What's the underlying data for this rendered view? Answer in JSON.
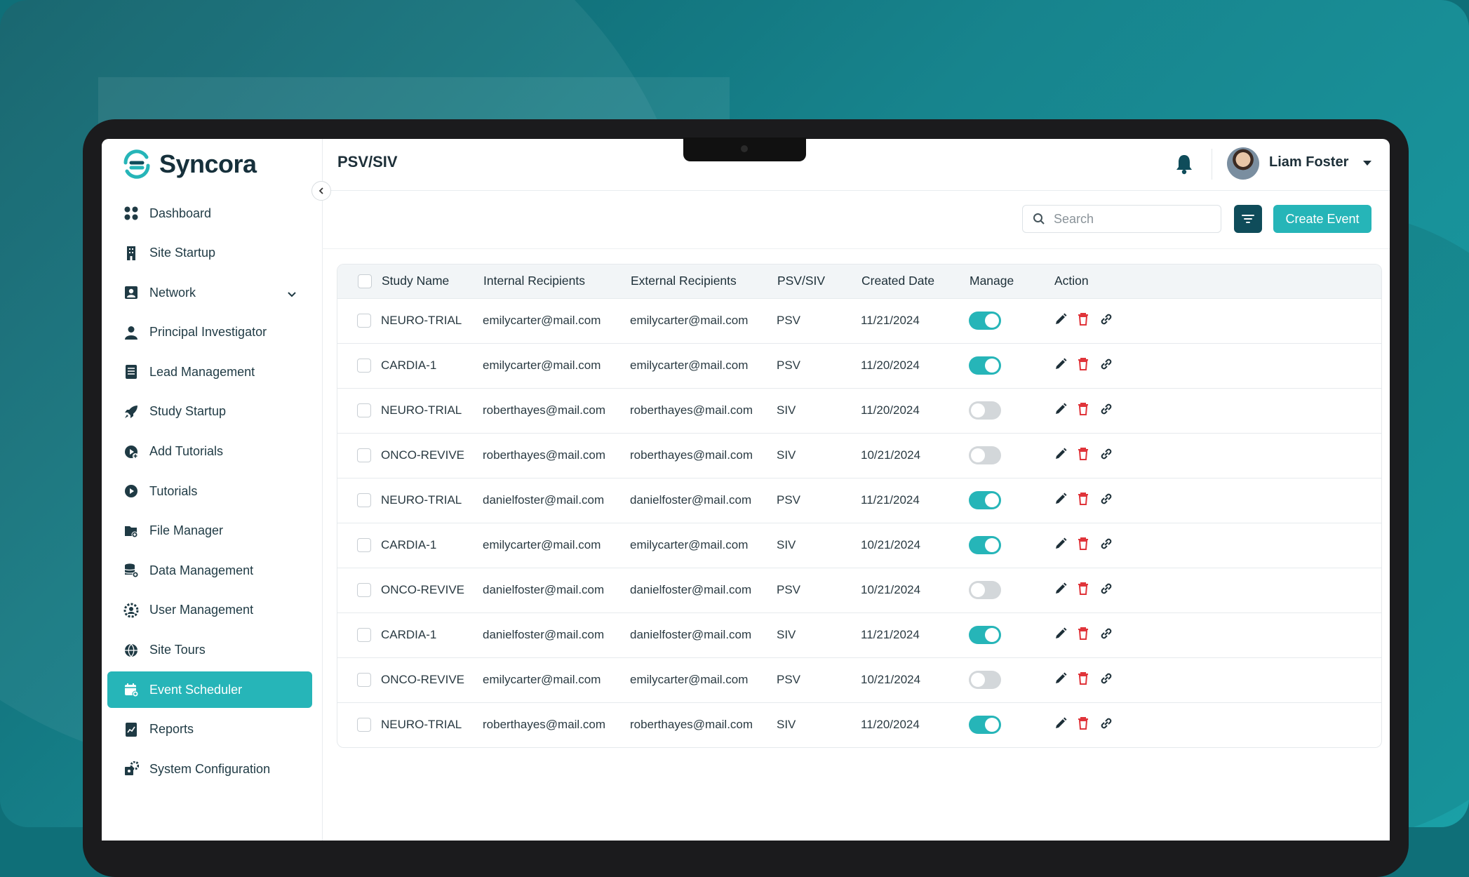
{
  "app": {
    "name": "Syncora"
  },
  "page": {
    "title": "PSV/SIV"
  },
  "user": {
    "name": "Liam Foster"
  },
  "sidebar": {
    "items": [
      {
        "label": "Dashboard",
        "icon": "grid-icon"
      },
      {
        "label": "Site Startup",
        "icon": "building-icon"
      },
      {
        "label": "Network",
        "icon": "contact-card-icon",
        "expandable": true
      },
      {
        "label": "Principal Investigator",
        "icon": "person-icon"
      },
      {
        "label": "Lead Management",
        "icon": "document-list-icon"
      },
      {
        "label": "Study Startup",
        "icon": "rocket-icon"
      },
      {
        "label": "Add Tutorials",
        "icon": "add-video-icon"
      },
      {
        "label": "Tutorials",
        "icon": "play-circle-icon"
      },
      {
        "label": "File Manager",
        "icon": "folder-gear-icon"
      },
      {
        "label": "Data Management",
        "icon": "database-gear-icon"
      },
      {
        "label": "User Management",
        "icon": "user-gear-icon"
      },
      {
        "label": "Site Tours",
        "icon": "globe-icon"
      },
      {
        "label": "Event Scheduler",
        "icon": "calendar-gear-icon",
        "active": true
      },
      {
        "label": "Reports",
        "icon": "report-icon"
      },
      {
        "label": "System Configuration",
        "icon": "system-config-icon"
      }
    ]
  },
  "toolbar": {
    "search_placeholder": "Search",
    "create_label": "Create Event"
  },
  "table": {
    "columns": [
      "Study Name",
      "Internal Recipients",
      "External Recipients",
      "PSV/SIV",
      "Created Date",
      "Manage",
      "Action"
    ],
    "rows": [
      {
        "study": "NEURO-TRIAL",
        "internal": "emilycarter@mail.com",
        "external": "emilycarter@mail.com",
        "type": "PSV",
        "date": "11/21/2024",
        "manage": true
      },
      {
        "study": "CARDIA-1",
        "internal": "emilycarter@mail.com",
        "external": "emilycarter@mail.com",
        "type": "PSV",
        "date": "11/20/2024",
        "manage": true
      },
      {
        "study": "NEURO-TRIAL",
        "internal": "roberthayes@mail.com",
        "external": "roberthayes@mail.com",
        "type": "SIV",
        "date": "11/20/2024",
        "manage": false
      },
      {
        "study": "ONCO-REVIVE",
        "internal": "roberthayes@mail.com",
        "external": "roberthayes@mail.com",
        "type": "SIV",
        "date": "10/21/2024",
        "manage": false
      },
      {
        "study": "NEURO-TRIAL",
        "internal": "danielfoster@mail.com",
        "external": "danielfoster@mail.com",
        "type": "PSV",
        "date": "11/21/2024",
        "manage": true
      },
      {
        "study": "CARDIA-1",
        "internal": "emilycarter@mail.com",
        "external": "emilycarter@mail.com",
        "type": "SIV",
        "date": "10/21/2024",
        "manage": true
      },
      {
        "study": "ONCO-REVIVE",
        "internal": "danielfoster@mail.com",
        "external": "danielfoster@mail.com",
        "type": "PSV",
        "date": "10/21/2024",
        "manage": false
      },
      {
        "study": "CARDIA-1",
        "internal": "danielfoster@mail.com",
        "external": "danielfoster@mail.com",
        "type": "SIV",
        "date": "11/21/2024",
        "manage": true
      },
      {
        "study": "ONCO-REVIVE",
        "internal": "emilycarter@mail.com",
        "external": "emilycarter@mail.com",
        "type": "PSV",
        "date": "10/21/2024",
        "manage": false
      },
      {
        "study": "NEURO-TRIAL",
        "internal": "roberthayes@mail.com",
        "external": "roberthayes@mail.com",
        "type": "SIV",
        "date": "11/20/2024",
        "manage": true
      }
    ]
  },
  "colors": {
    "accent": "#26b5b8",
    "dark": "#0f4c5a",
    "delete": "#e0343a"
  }
}
